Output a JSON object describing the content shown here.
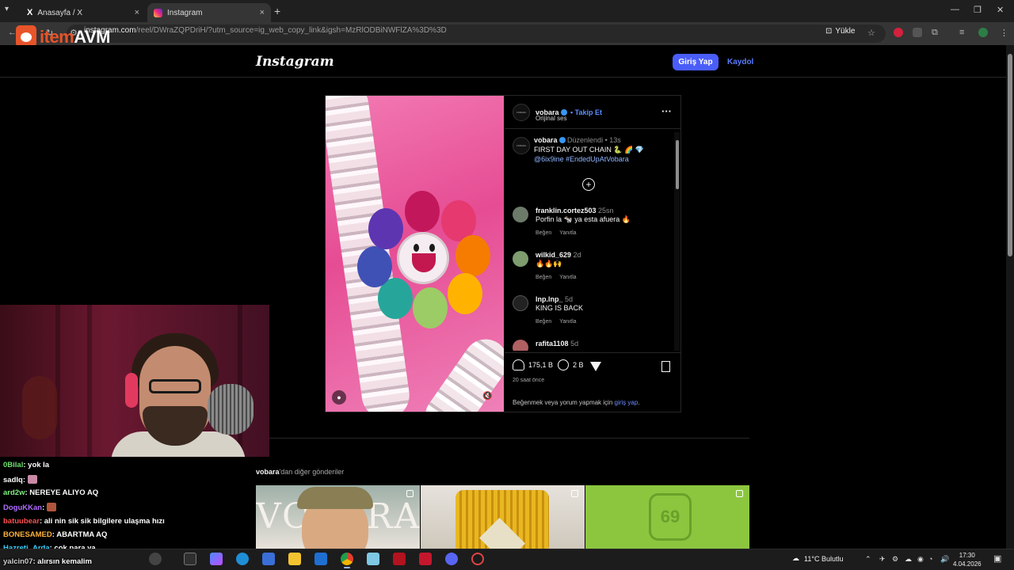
{
  "browser": {
    "tabs": [
      {
        "label": "Anasayfa / X",
        "close": "×"
      },
      {
        "label": "Instagram",
        "close": "×"
      }
    ],
    "new_tab": "+",
    "url_prefix": "instagram.com",
    "url_rest": "/reel/DWraZQPDriH/?utm_source=ig_web_copy_link&igsh=MzRlODBiNWFlZA%3D%3D",
    "url_overlay_prefix": "w",
    "upload_label": "Yükle"
  },
  "overlay_logo": {
    "left": "item",
    "right": "AVM"
  },
  "instagram": {
    "logo": "Instagram",
    "login_button": "Giriş Yap",
    "signup_link": "Kaydol",
    "post": {
      "author": "vobara",
      "follow": "• Takip Et",
      "audio": "Orijinal ses",
      "caption_author": "vobara",
      "caption_meta": "Düzenlendi • 13s",
      "caption_text": "FIRST DAY OUT CHAIN 🐍 🌈 💎",
      "caption_tags": "@6ix9ine #EndedUpAtVobara",
      "comments": [
        {
          "user": "franklin.cortez503",
          "time": "25sn",
          "text": "Porfin la 🐄 ya esta afuera 🔥",
          "like": "Beğen",
          "reply": "Yanıtla"
        },
        {
          "user": "wilkid_629",
          "time": "2d",
          "text": "🔥🔥🙌",
          "like": "Beğen",
          "reply": "Yanıtla"
        },
        {
          "user": "lnp.lnp_",
          "time": "5d",
          "text": "KING IS BACK",
          "like": "Beğen",
          "reply": "Yanıtla"
        },
        {
          "user": "rafita1108",
          "time": "5d",
          "text": "",
          "like": "",
          "reply": ""
        }
      ],
      "likes": "175,1 B",
      "comment_count": "2 B",
      "time_ago": "20 saat önce",
      "login_note_pre": "Beğenmek veya yorum yapmak için ",
      "login_note_link": "giriş yap",
      "login_note_post": "."
    },
    "more_posts_user": "vobara",
    "more_posts_suffix": "'dan diğer gönderiler",
    "thumb_texts": [
      "VOBARA",
      "",
      "69"
    ]
  },
  "chat": [
    {
      "user": "0Bilal",
      "msg": ": yok la",
      "color": "#6ee06e"
    },
    {
      "user": "sadlq",
      "msg": ":",
      "color": "#ffffff",
      "emote": true
    },
    {
      "user": "ard2w",
      "msg": ": NEREYE ALIYO AQ",
      "color": "#7ef07e"
    },
    {
      "user": "DoguKKan",
      "msg": ":",
      "color": "#b06cff",
      "emote": true
    },
    {
      "user": "batuubear",
      "msg": ": ali nin sik sik bilgilere ulaşma hızı",
      "color": "#ff4f4f"
    },
    {
      "user": "BONESAMED",
      "msg": ": ABARTMA AQ",
      "color": "#ffb33a"
    },
    {
      "user": "Hazreti_Arda",
      "msg": ": çok para ya",
      "color": "#37d1ff"
    },
    {
      "user": "yalcin07",
      "msg": ": alırsın kemalim",
      "color": "#cfcfcf"
    }
  ],
  "taskbar": {
    "weather": "11°C  Bulutlu",
    "time": "17:30",
    "date": "4.04.2026"
  },
  "colors": {
    "instagram_blue": "#4a5df9",
    "link_blue": "#5b8cff",
    "page_bg": "#000000"
  }
}
